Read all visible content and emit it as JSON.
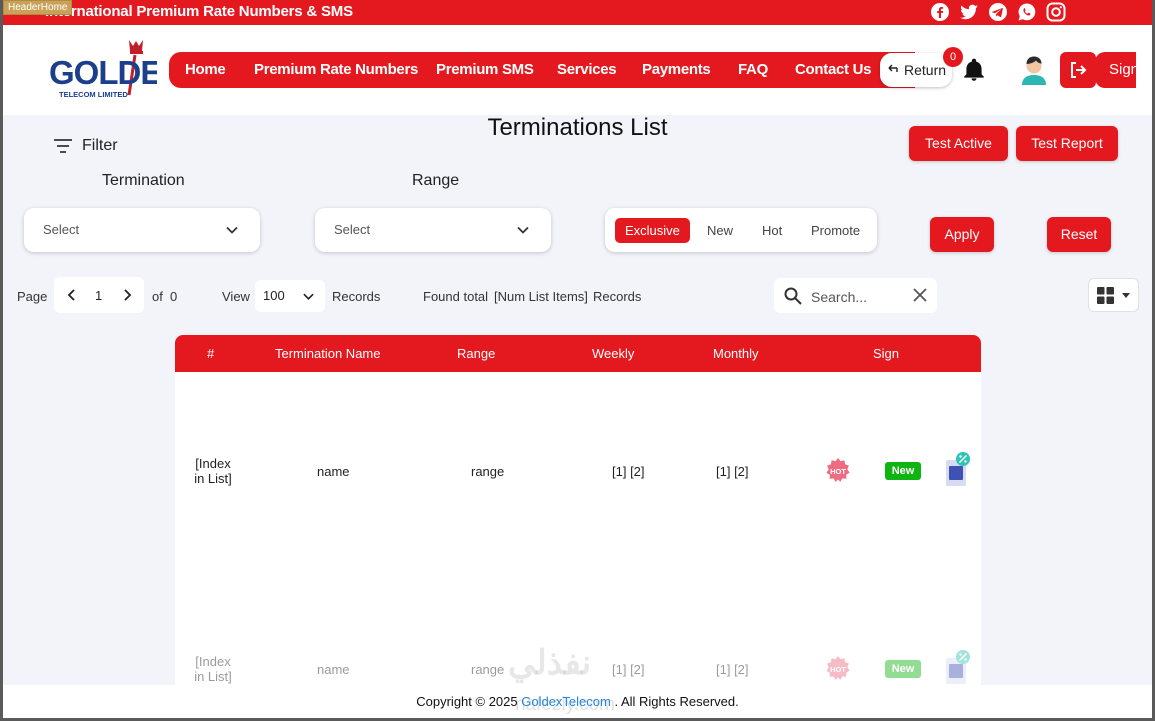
{
  "frame_label": "HeaderHome",
  "topbar": {
    "title": "International Premium Rate Numbers & SMS"
  },
  "socials": [
    "facebook-icon",
    "twitter-icon",
    "telegram-icon",
    "whatsapp-icon",
    "instagram-icon"
  ],
  "header": {
    "logo_text": "GOLDEX",
    "logo_subtext": "TELECOM LIMITED",
    "nav": [
      "Home",
      "Premium Rate Numbers",
      "Premium SMS",
      "Services",
      "Payments",
      "FAQ",
      "Contact Us"
    ],
    "return_label": "Return",
    "notification_count": "0",
    "sign_label": "Sign"
  },
  "page_title": "Terminations List",
  "filter": {
    "label": "Filter",
    "termination_label": "Termination",
    "range_label": "Range",
    "termination_placeholder": "Select",
    "range_placeholder": "Select",
    "segments": [
      "Exclusive",
      "New",
      "Hot",
      "Promote"
    ],
    "active_segment": "Exclusive",
    "apply_label": "Apply",
    "reset_label": "Reset",
    "test_active_label": "Test Active",
    "test_report_label": "Test Report"
  },
  "pager": {
    "page_label": "Page",
    "page_value": "1",
    "of_label": "of",
    "total_pages": "0",
    "view_label": "View",
    "view_value": "100",
    "records_label": "Records",
    "found_label": "Found total",
    "found_value": "[Num List Items]",
    "found_records_label": "Records",
    "search_placeholder": "Search..."
  },
  "table": {
    "headers": [
      "#",
      "Termination Name",
      "Range",
      "Weekly",
      "Monthly",
      "Sign"
    ],
    "rows": [
      {
        "index_line1": "[Index",
        "index_line2": "in List]",
        "name": "name",
        "range": "range",
        "weekly": "[1] [2]",
        "monthly": "[1] [2]",
        "hot": "HOT",
        "badge": "New"
      },
      {
        "index_line1": "[Index",
        "index_line2": "in List]",
        "name": "name",
        "range": "range",
        "weekly": "[1] [2]",
        "monthly": "[1] [2]",
        "hot": "HOT",
        "badge": "New"
      }
    ]
  },
  "footer": {
    "prefix": "Copyright © 2025 ",
    "brand": "GoldexTelecom",
    "suffix": " . All Rights Reserved."
  },
  "watermark": {
    "arabic": "نفذلي",
    "latin": "nafezly.com"
  },
  "colors": {
    "brand_red": "#e3191f",
    "badge_green": "#10b410",
    "link_blue": "#1e88e5",
    "background": "#f3f4fa"
  }
}
